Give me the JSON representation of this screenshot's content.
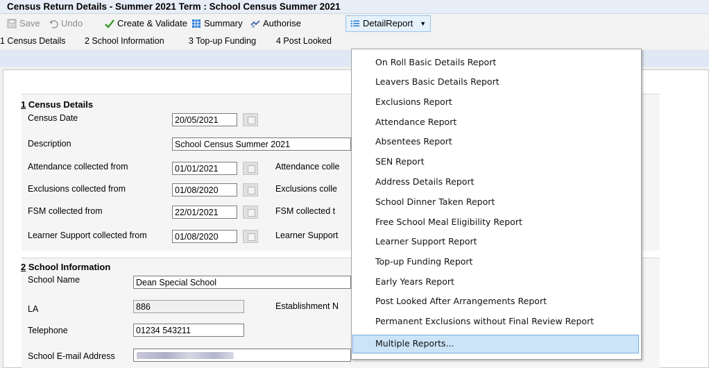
{
  "window": {
    "title": "Census Return Details - Summer 2021 Term : School Census Summer 2021"
  },
  "toolbar": {
    "save": "Save",
    "undo": "Undo",
    "create_validate": "Create & Validate",
    "summary": "Summary",
    "authorise": "Authorise",
    "detail_report": "DetailReport"
  },
  "tabs": [
    "1 Census Details",
    "2 School Information",
    "3 Top-up Funding",
    "4 Post Looked"
  ],
  "census": {
    "title_num": "1",
    "title_text": " Census Details",
    "census_date_label": "Census Date",
    "census_date": "20/05/2021",
    "description_label": "Description",
    "description": "School Census Summer 2021",
    "attendance_from_label": "Attendance collected from",
    "attendance_from": "01/01/2021",
    "attendance_to_label": "Attendance colle",
    "exclusions_from_label": "Exclusions collected from",
    "exclusions_from": "01/08/2020",
    "exclusions_to_label": "Exclusions colle",
    "fsm_from_label": "FSM collected from",
    "fsm_from": "22/01/2021",
    "fsm_to_label": "FSM collected t",
    "ls_from_label": "Learner Support collected from",
    "ls_from": "01/08/2020",
    "ls_to_label": "Learner Support"
  },
  "school": {
    "title_num": "2",
    "title_text": " School Information",
    "name_label": "School Name",
    "name": "Dean Special School",
    "la_label": "LA",
    "la": "886",
    "estab_label": "Establishment N",
    "tel_label": "Telephone",
    "tel": "01234 543211",
    "email_label": "School E-mail Address"
  },
  "menu": {
    "items": [
      "On Roll Basic Details Report",
      "Leavers Basic Details Report",
      "Exclusions Report",
      "Attendance Report",
      "Absentees Report",
      "SEN Report",
      "Address Details Report",
      "School Dinner Taken Report",
      "Free School Meal Eligibility Report",
      "Learner Support Report",
      "Top-up Funding Report",
      "Early Years Report",
      "Post Looked After Arrangements Report",
      "Permanent Exclusions without Final Review Report",
      "Multiple Reports..."
    ]
  },
  "colors": {
    "accent": "#0a64c8",
    "highlight": "#cce4f7",
    "check_green": "#3a9a2a"
  }
}
